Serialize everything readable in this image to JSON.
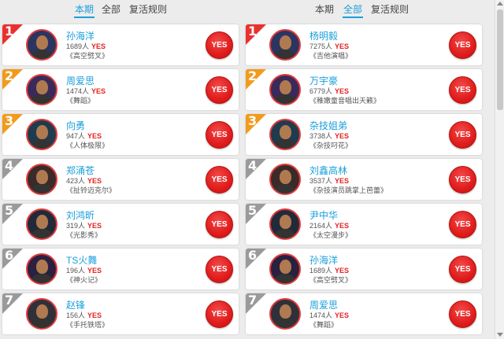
{
  "colors": {
    "accent": "#1a9fdb",
    "vote": "#e52222",
    "rank_top": "#e8322f",
    "rank_mid": "#f29a1c",
    "rank_low": "#9a9a9a"
  },
  "left": {
    "tabs": [
      {
        "label": "本期",
        "active": true
      },
      {
        "label": "全部",
        "active": false
      },
      {
        "label": "复活规则",
        "active": false
      }
    ],
    "items": [
      {
        "rank": "1",
        "name": "孙海洋",
        "count": "1689人",
        "yes": "YES",
        "program": "《高空劈叉》",
        "vote": "YES",
        "tier": "top"
      },
      {
        "rank": "2",
        "name": "周爱思",
        "count": "1474人",
        "yes": "YES",
        "program": "《舞蹈》",
        "vote": "YES",
        "tier": "mid"
      },
      {
        "rank": "3",
        "name": "向勇",
        "count": "947人",
        "yes": "YES",
        "program": "《人体极限》",
        "vote": "YES",
        "tier": "mid"
      },
      {
        "rank": "4",
        "name": "郑涌苍",
        "count": "423人",
        "yes": "YES",
        "program": "《扯铃迈克尔》",
        "vote": "YES",
        "tier": "low"
      },
      {
        "rank": "5",
        "name": "刘鸿昕",
        "count": "319人",
        "yes": "YES",
        "program": "《光影秀》",
        "vote": "YES",
        "tier": "low"
      },
      {
        "rank": "6",
        "name": "TS火舞",
        "count": "196人",
        "yes": "YES",
        "program": "《神火记》",
        "vote": "YES",
        "tier": "low"
      },
      {
        "rank": "7",
        "name": "赵锋",
        "count": "156人",
        "yes": "YES",
        "program": "《手托铁塔》",
        "vote": "YES",
        "tier": "low"
      }
    ]
  },
  "right": {
    "tabs": [
      {
        "label": "本期",
        "active": false
      },
      {
        "label": "全部",
        "active": true
      },
      {
        "label": "复活规则",
        "active": false
      }
    ],
    "items": [
      {
        "rank": "1",
        "name": "杨明毅",
        "count": "7275人",
        "yes": "YES",
        "program": "《吉他演唱》",
        "vote": "YES",
        "tier": "top"
      },
      {
        "rank": "2",
        "name": "万宇豪",
        "count": "6779人",
        "yes": "YES",
        "program": "《稚嫩童音唱出天籁》",
        "vote": "YES",
        "tier": "mid"
      },
      {
        "rank": "3",
        "name": "杂技姐弟",
        "count": "3738人",
        "yes": "YES",
        "program": "《杂技叼花》",
        "vote": "YES",
        "tier": "mid"
      },
      {
        "rank": "4",
        "name": "刘鑫高林",
        "count": "3537人",
        "yes": "YES",
        "program": "《杂技演员跳掌上芭蕾》",
        "vote": "YES",
        "tier": "low"
      },
      {
        "rank": "5",
        "name": "尹中华",
        "count": "2164人",
        "yes": "YES",
        "program": "《太空漫步》",
        "vote": "YES",
        "tier": "low"
      },
      {
        "rank": "6",
        "name": "孙海洋",
        "count": "1689人",
        "yes": "YES",
        "program": "《高空劈叉》",
        "vote": "YES",
        "tier": "low"
      },
      {
        "rank": "7",
        "name": "周爱思",
        "count": "1474人",
        "yes": "YES",
        "program": "《舞蹈》",
        "vote": "YES",
        "tier": "low"
      }
    ]
  }
}
